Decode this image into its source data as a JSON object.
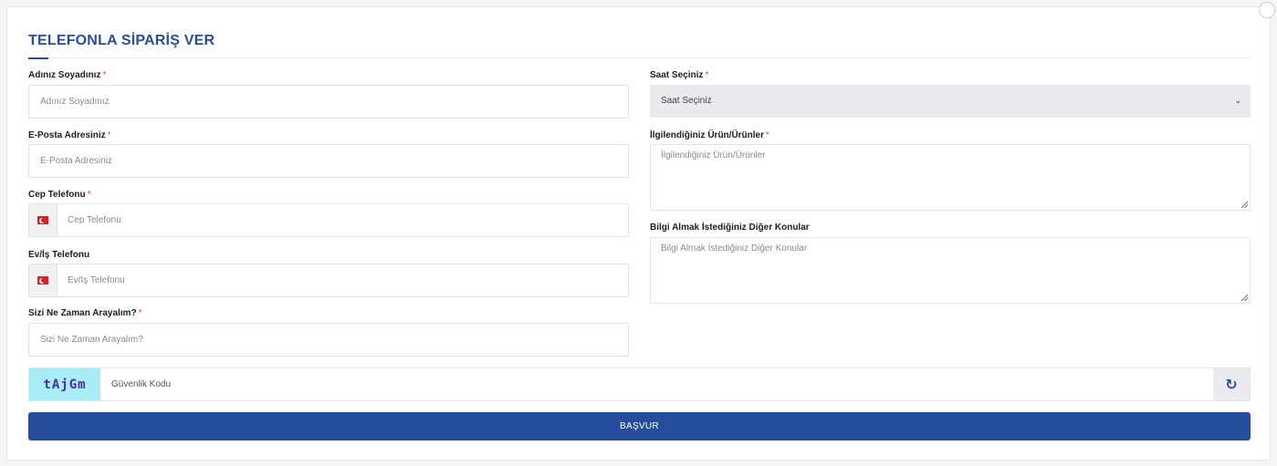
{
  "form": {
    "title": "TELEFONLA SİPARİŞ VER",
    "required_mark": "*",
    "name": {
      "label": "Adınız Soyadınız",
      "placeholder": "Adınız Soyadınız",
      "value": ""
    },
    "email": {
      "label": "E-Posta Adresiniz",
      "placeholder": "E-Posta Adresiniz",
      "value": ""
    },
    "mobile": {
      "label": "Cep Telefonu",
      "placeholder": "Cep Telefonu",
      "value": "",
      "flag": "turkey-flag-icon"
    },
    "home_phone": {
      "label": "Ev/İş Telefonu",
      "placeholder": "Ev/İş Telefonu",
      "value": "",
      "flag": "turkey-flag-icon"
    },
    "call_time": {
      "label": "Sizi Ne Zaman Arayalım?",
      "placeholder": "Sizi Ne Zaman Arayalım?",
      "value": ""
    },
    "hour": {
      "label": "Saat Seçiniz",
      "selected": "Saat Seçiniz"
    },
    "products": {
      "label": "İlgilendiğiniz Ürün/Ürünler",
      "placeholder": "İlgilendiğiniz Ürün/Ürünler",
      "value": ""
    },
    "other_topics": {
      "label": "Bilgi Almak İstediğiniz Diğer Konular",
      "placeholder": "Bilgi Almak İstediğiniz Diğer Konular",
      "value": ""
    },
    "captcha": {
      "code": "tAjGm",
      "placeholder": "Güvenlik Kodu",
      "refresh_icon": "refresh-icon"
    },
    "submit_label": "BAŞVUR"
  },
  "colors": {
    "primary": "#264d9b",
    "required": "#e64a3c",
    "select_bg": "#e9ebee",
    "captcha_bg": "#a9edf7"
  }
}
